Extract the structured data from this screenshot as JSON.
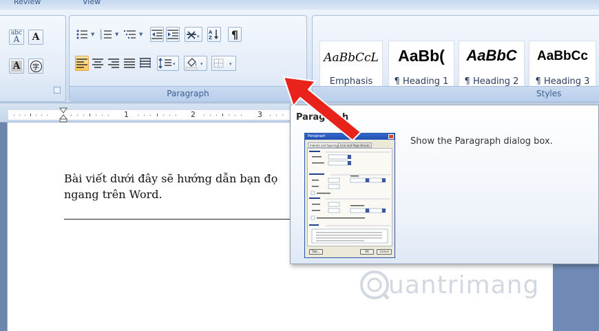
{
  "ribbon": {
    "tabs": [
      "Review",
      "View"
    ],
    "paragraph_group": {
      "label": "Paragraph",
      "buttons": [
        "bullets",
        "numbering",
        "multilevel-list",
        "decrease-indent",
        "increase-indent",
        "sort",
        "show-formatting",
        "align-left",
        "center",
        "align-right",
        "justify",
        "distributed",
        "line-spacing",
        "shading",
        "borders"
      ]
    },
    "font_group_partial": {
      "abc_label": "abc",
      "a_label": "A",
      "circled_a": "A",
      "circled_char": "字"
    },
    "styles_group": {
      "label": "Styles",
      "items": [
        {
          "sample": "AaBbCcL",
          "name": "Emphasis"
        },
        {
          "sample": "AaBb(",
          "name": "¶ Heading 1"
        },
        {
          "sample": "AaBbC",
          "name": "¶ Heading 2"
        },
        {
          "sample": "AaBbCc",
          "name": "¶ Heading 3"
        }
      ]
    }
  },
  "ruler": {
    "numbers": [
      "1",
      "2",
      "3"
    ]
  },
  "document": {
    "line1": "Bài viết dưới đây sẽ hướng dẫn bạn đọ",
    "line2": "ngang trên Word."
  },
  "tooltip": {
    "title": "Paragraph",
    "description": "Show the Paragraph dialog box.",
    "thumbnail": {
      "title": "Paragraph",
      "tabs": [
        "Indents and Spacing",
        "Line and Page Breaks"
      ],
      "buttons": [
        "Tabs...",
        "OK",
        "Cancel"
      ]
    }
  },
  "watermark": {
    "text": "uantrimang"
  },
  "colors": {
    "accent_red": "#e8231c",
    "ribbon_blue": "#c9dbf0",
    "active_orange": "#ffc95a"
  }
}
